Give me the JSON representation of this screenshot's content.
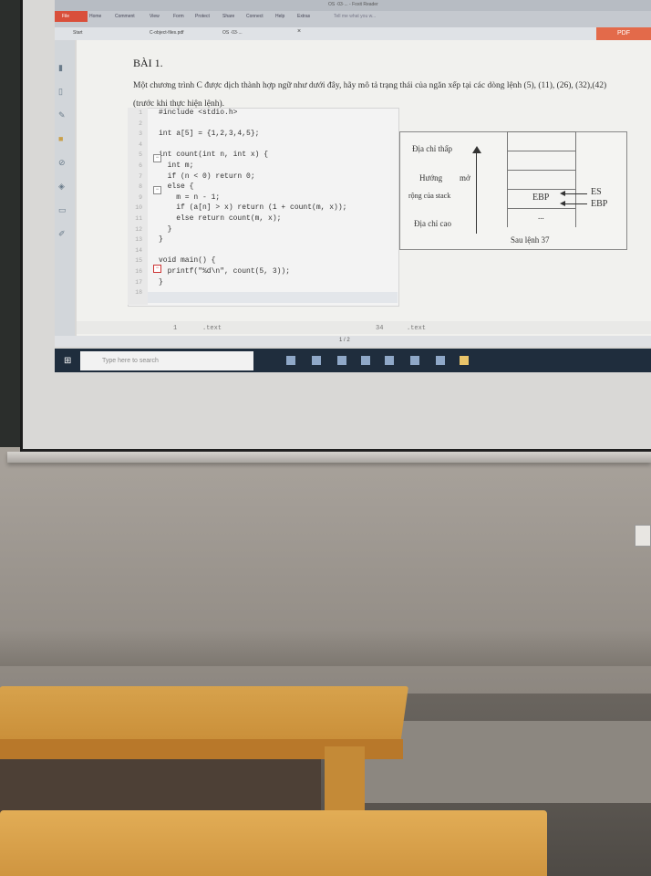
{
  "viewer": {
    "window_title": "OS ·03·...  - Foxit Reader",
    "menu": [
      "File",
      "Home",
      "Comment",
      "View",
      "Form",
      "Protect",
      "Share",
      "Connect",
      "Help",
      "Extras"
    ],
    "tell_me": "Tell me what you w...",
    "tabs": [
      "Start",
      "C-object-files.pdf",
      "OS ·03·..."
    ],
    "pdf_badge": "PDF",
    "page_indicator": "1 / 2",
    "search_placeholder": "Type here to search"
  },
  "document": {
    "heading": "BÀI 1.",
    "question": "Một chương trình C được dịch thành hợp ngữ như dưới đây, hãy mô tả trạng thái của ngăn xếp tại các dòng lệnh (5), (11), (26), (32),(42) (trước khi thực hiện lệnh).",
    "code": [
      {
        "n": "1",
        "t": "#include <stdio.h>"
      },
      {
        "n": "2",
        "t": ""
      },
      {
        "n": "3",
        "t": "int a[5] = {1,2,3,4,5};"
      },
      {
        "n": "4",
        "t": ""
      },
      {
        "n": "5",
        "t": "int count(int n, int x) {"
      },
      {
        "n": "6",
        "t": "  int m;"
      },
      {
        "n": "7",
        "t": "  if (n < 0) return 0;"
      },
      {
        "n": "8",
        "t": "  else {"
      },
      {
        "n": "9",
        "t": "    m = n - 1;"
      },
      {
        "n": "10",
        "t": "    if (a[n] > x) return (1 + count(m, x));"
      },
      {
        "n": "11",
        "t": "    else return count(m, x);"
      },
      {
        "n": "12",
        "t": "  }"
      },
      {
        "n": "13",
        "t": "}"
      },
      {
        "n": "14",
        "t": ""
      },
      {
        "n": "15",
        "t": "void main() {"
      },
      {
        "n": "16",
        "t": "  printf(\"%d\\n\", count(5, 3));"
      },
      {
        "n": "17",
        "t": "}"
      },
      {
        "n": "18",
        "t": ""
      }
    ],
    "status_left_num": "1",
    "status_left": ".text",
    "status_right_num": "34",
    "status_right": ".text"
  },
  "diagram": {
    "low_addr": "Địa chỉ thấp",
    "growth_1": "Hướng",
    "growth_2": "mở",
    "growth_3": "rộng của stack",
    "high_addr": "Địa chỉ cao",
    "ebp_cell": "EBP",
    "esp": "ES",
    "ebp": "EBP",
    "dots": "...",
    "caption": "Sau lệnh 37"
  }
}
